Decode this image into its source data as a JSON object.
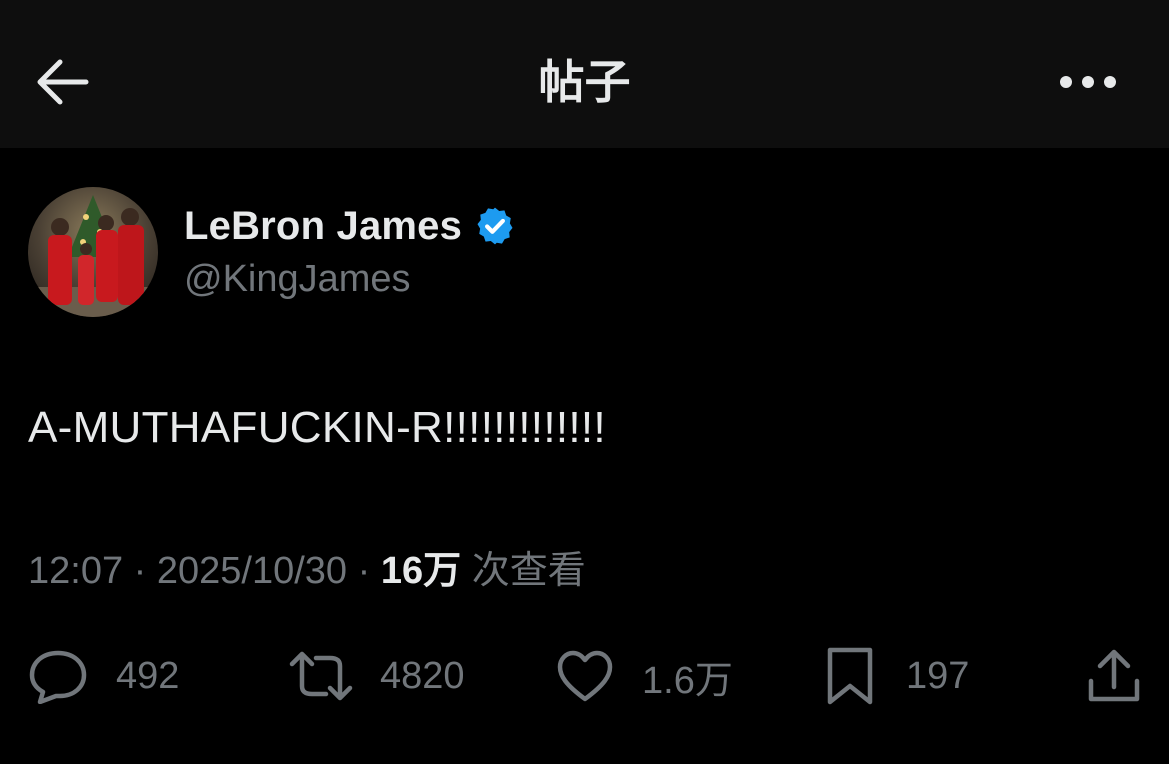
{
  "header": {
    "title": "帖子",
    "back_icon": "arrow-left-icon",
    "more_icon": "more-horizontal-icon"
  },
  "author": {
    "display_name": "LeBron James",
    "handle": "@KingJames",
    "verified": true,
    "verified_color": "#1d9bf0",
    "avatar_icon": "profile-photo"
  },
  "post": {
    "text": "A-MUTHAFUCKIN-R!!!!!!!!!!!!!",
    "time": "12:07",
    "date": "2025/10/30",
    "views_count": "16万",
    "views_label": "次查看"
  },
  "actions": {
    "reply_count": "492",
    "repost_count": "4820",
    "like_count": "1.6万",
    "bookmark_count": "197"
  },
  "colors": {
    "background": "#000000",
    "header_background": "#0e0e0e",
    "primary_text": "#e7e9ea",
    "secondary_text": "#71767b",
    "accent": "#1d9bf0"
  }
}
